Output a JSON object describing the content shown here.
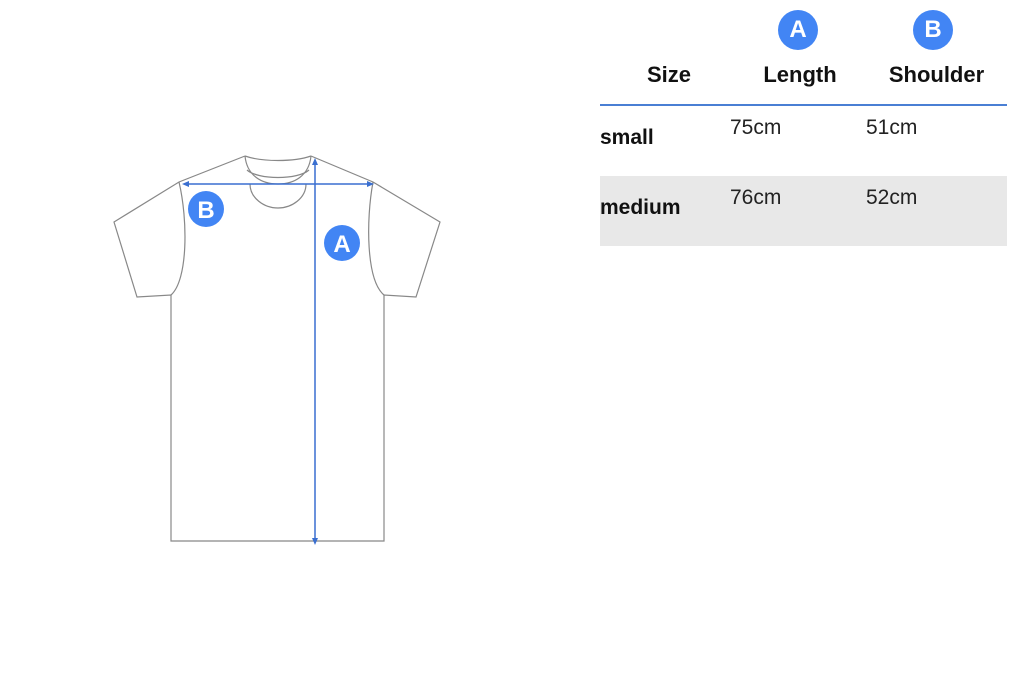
{
  "colors": {
    "accent": "#4285f4",
    "rule": "#4a7fd4",
    "row_alt": "#e8e8e8",
    "outline": "#888888",
    "arrow": "#3a6fd0"
  },
  "diagram": {
    "marker_a": "A",
    "marker_b": "B"
  },
  "table": {
    "badges": {
      "length": "A",
      "shoulder": "B"
    },
    "headers": {
      "size": "Size",
      "length": "Length",
      "shoulder": "Shoulder"
    },
    "rows": [
      {
        "size": "small",
        "length": "75cm",
        "shoulder": "51cm"
      },
      {
        "size": "medium",
        "length": "76cm",
        "shoulder": "52cm"
      }
    ]
  }
}
